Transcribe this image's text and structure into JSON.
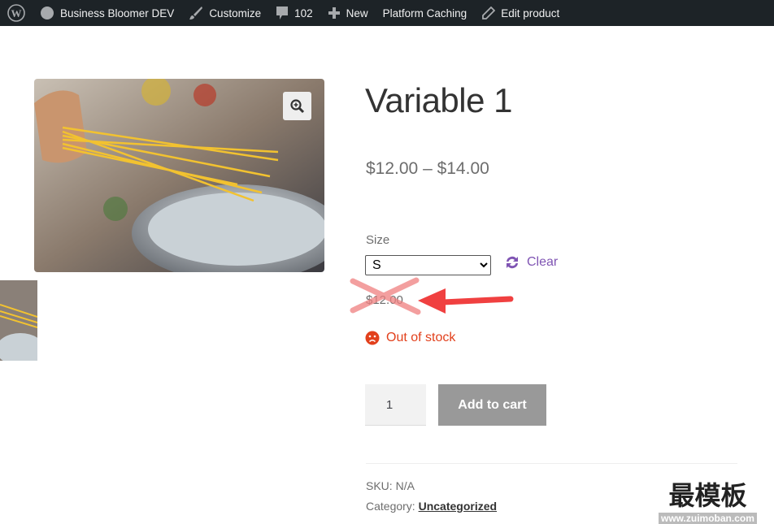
{
  "admin_bar": {
    "site_name": "Business Bloomer DEV",
    "customize": "Customize",
    "comments": "102",
    "new": "New",
    "caching": "Platform Caching",
    "edit": "Edit product"
  },
  "product": {
    "title": "Variable 1",
    "price_range": "$12.00 – $14.00",
    "attribute_label": "Size",
    "selected_size": "S",
    "clear_label": "Clear",
    "variation_price": "$12.00",
    "stock_status": "Out of stock",
    "quantity": "1",
    "add_to_cart": "Add to cart",
    "sku_label": "SKU:",
    "sku": "N/A",
    "category_label": "Category:",
    "category": "Uncategorized"
  },
  "watermark": {
    "text": "最模板",
    "url": "www.zuimoban.com"
  },
  "colors": {
    "admin_bar": "#1d2327",
    "accent": "#7f54b3",
    "out_of_stock": "#e2401c",
    "annotation": "#f04040"
  }
}
